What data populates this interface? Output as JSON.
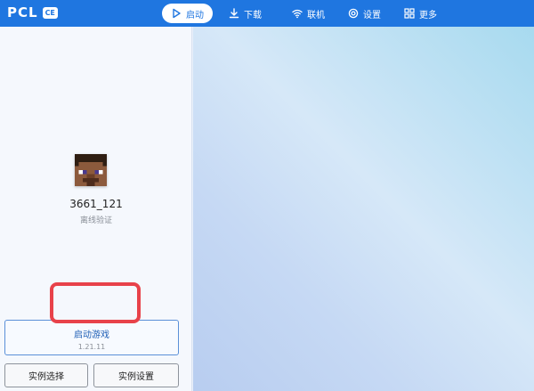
{
  "app": {
    "name": "PCL",
    "badge": "CE"
  },
  "nav": {
    "launch": "启动",
    "download": "下载",
    "online": "联机",
    "settings": "设置",
    "more": "更多"
  },
  "profile": {
    "username": "3661_121",
    "auth_type": "离线验证"
  },
  "actions": {
    "launch_label": "启动游戏",
    "launch_version": "1.21.11",
    "instance_select": "实例选择",
    "instance_settings": "实例设置"
  },
  "colors": {
    "accent": "#1f76e0",
    "highlight": "#e8424a"
  }
}
